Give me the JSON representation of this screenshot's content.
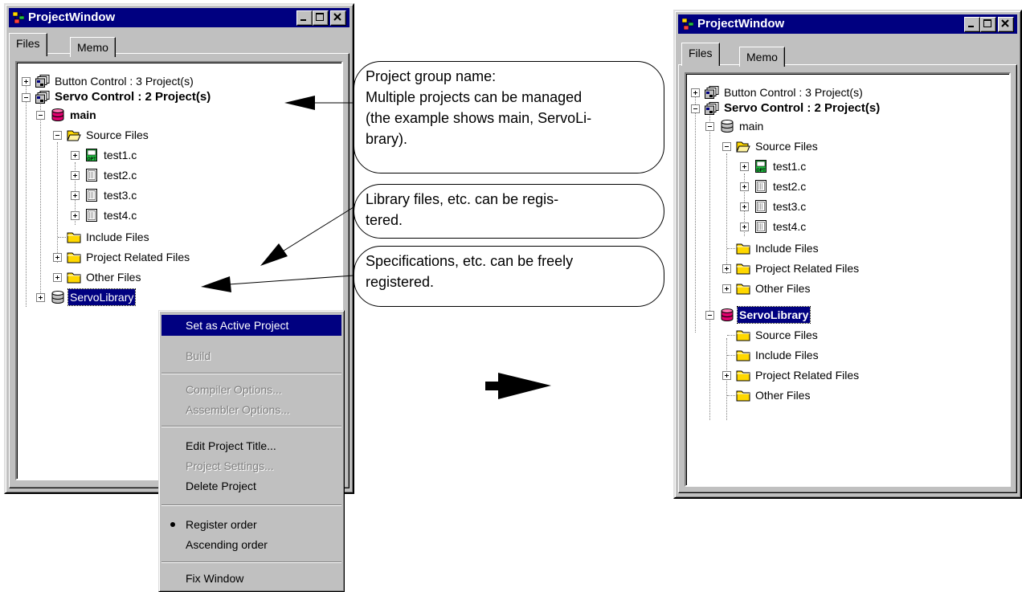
{
  "left_window": {
    "title": "ProjectWindow",
    "tabs": [
      "Files",
      "Memo"
    ],
    "tree": [
      {
        "label": "Button Control : 3 Project(s)"
      },
      {
        "label": "Servo Control : 2 Project(s)"
      },
      {
        "label": "main"
      },
      {
        "label": "Source Files"
      },
      {
        "label": "test1.c"
      },
      {
        "label": "test2.c"
      },
      {
        "label": "test3.c"
      },
      {
        "label": "test4.c"
      },
      {
        "label": "Include Files"
      },
      {
        "label": "Project Related Files"
      },
      {
        "label": "Other Files"
      },
      {
        "label": "ServoLibrary"
      }
    ]
  },
  "context_menu": {
    "items": [
      {
        "label": "Set as Active Project",
        "state": "highlighted"
      },
      {
        "label": "Build",
        "state": "disabled"
      },
      {
        "label": "Compiler Options...",
        "state": "disabled"
      },
      {
        "label": "Assembler Options...",
        "state": "disabled"
      },
      {
        "label": "Edit Project Title...",
        "state": "enabled"
      },
      {
        "label": "Project Settings...",
        "state": "disabled"
      },
      {
        "label": "Delete Project",
        "state": "enabled"
      },
      {
        "label": "Register order",
        "state": "checked"
      },
      {
        "label": "Ascending order",
        "state": "enabled"
      },
      {
        "label": "Fix Window",
        "state": "enabled"
      }
    ]
  },
  "callouts": [
    {
      "lines": [
        "Project group name:",
        "Multiple projects can be managed",
        "(the example shows main, ServoLi-",
        "brary)."
      ]
    },
    {
      "lines": [
        "Library files, etc. can be regis-",
        "tered."
      ]
    },
    {
      "lines": [
        "Specifications, etc. can be freely",
        "registered."
      ]
    }
  ],
  "right_window": {
    "title": "ProjectWindow",
    "tabs": [
      "Files",
      "Memo"
    ],
    "tree": [
      {
        "label": "Button Control : 3 Project(s)"
      },
      {
        "label": "Servo Control : 2 Project(s)"
      },
      {
        "label": "main"
      },
      {
        "label": "Source Files"
      },
      {
        "label": "test1.c"
      },
      {
        "label": "test2.c"
      },
      {
        "label": "test3.c"
      },
      {
        "label": "test4.c"
      },
      {
        "label": "Include Files"
      },
      {
        "label": "Project Related Files"
      },
      {
        "label": "Other Files"
      },
      {
        "label": "ServoLibrary"
      },
      {
        "label": "Source Files"
      },
      {
        "label": "Include Files"
      },
      {
        "label": "Project Related Files"
      },
      {
        "label": "Other Files"
      }
    ]
  },
  "colors": {
    "titlebar": "#000080",
    "face": "#c0c0c0",
    "active_db": "#e0006e",
    "folder": "#ffd800",
    "opt_icon": "#20c040"
  }
}
